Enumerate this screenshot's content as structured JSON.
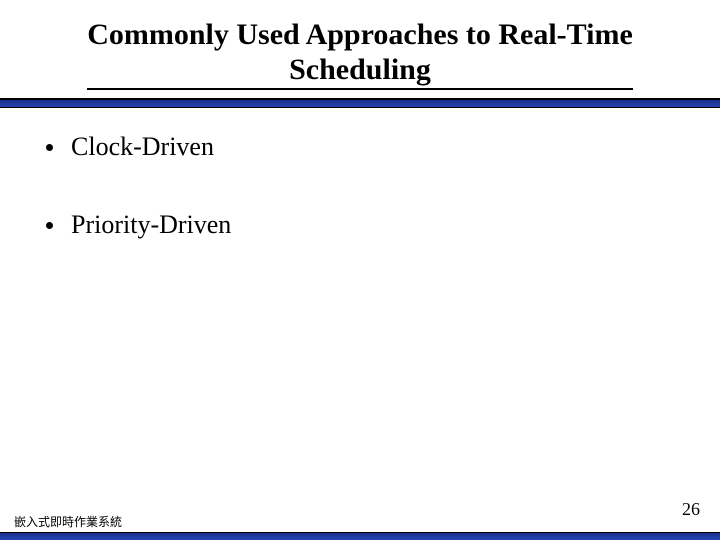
{
  "title": {
    "line1": "Commonly Used Approaches to Real-Time",
    "line2": "Scheduling"
  },
  "bullets": [
    "Clock-Driven",
    "Priority-Driven"
  ],
  "footer": {
    "label": "嵌入式即時作業系統",
    "page": "26"
  }
}
